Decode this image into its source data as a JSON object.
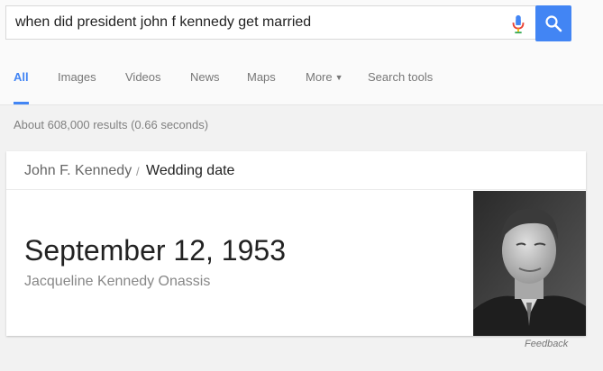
{
  "search": {
    "query": "when did president john f kennedy get married"
  },
  "tabs": [
    {
      "label": "All",
      "active": true
    },
    {
      "label": "Images"
    },
    {
      "label": "Videos"
    },
    {
      "label": "News"
    },
    {
      "label": "Maps"
    },
    {
      "label": "More"
    },
    {
      "label": "Search tools"
    }
  ],
  "results_stats": "About 608,000 results (0.66 seconds)",
  "answer_card": {
    "entity": "John F. Kennedy",
    "separator": "/",
    "attribute": "Wedding date",
    "answer": "September 12, 1953",
    "spouse": "Jacqueline Kennedy Onassis",
    "photo": "portrait-photo"
  },
  "feedback_label": "Feedback",
  "colors": {
    "accent": "#4285f4",
    "background": "#f2f2f2"
  },
  "icons": [
    "microphone-icon",
    "search-icon",
    "caret-down-icon"
  ]
}
